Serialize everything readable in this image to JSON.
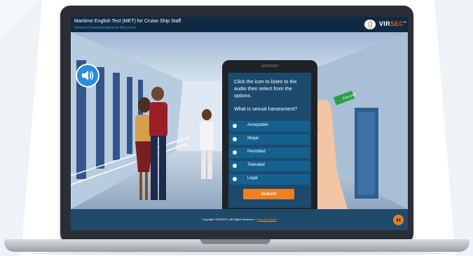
{
  "header": {
    "course_title": "Maritime English Test (MET) for Cruise Ship Staff",
    "course_subtitle": "General Communications for Non-Crew",
    "logo_text": "VIR",
    "logo_accent": "SEC",
    "logo_mark": "®"
  },
  "audio": {
    "icon": "speaker-icon"
  },
  "question": {
    "instruction": "Click the icon to listen to the audio then select from the options.",
    "prompt": "What is sexual harassment?",
    "options": [
      {
        "label": "Acceptable"
      },
      {
        "label": "Illegal"
      },
      {
        "label": "Permitted"
      },
      {
        "label": "Tolerated"
      },
      {
        "label": "Legal"
      }
    ],
    "submit_label": "Submit"
  },
  "scene": {
    "exit_sign": "Fire exit"
  },
  "footer": {
    "copyright": "Copyright VIRSEC® | All Rights Reserved",
    "separator": "|",
    "security_link": "Security Notice"
  },
  "colors": {
    "header_bg": "#0f2a42",
    "subtitle": "#3aa6e8",
    "phone_screen": "#1c4a6e",
    "option_bg": "#14618f",
    "accent_orange": "#f07f1c",
    "audio_blue": "#2a8be0"
  }
}
